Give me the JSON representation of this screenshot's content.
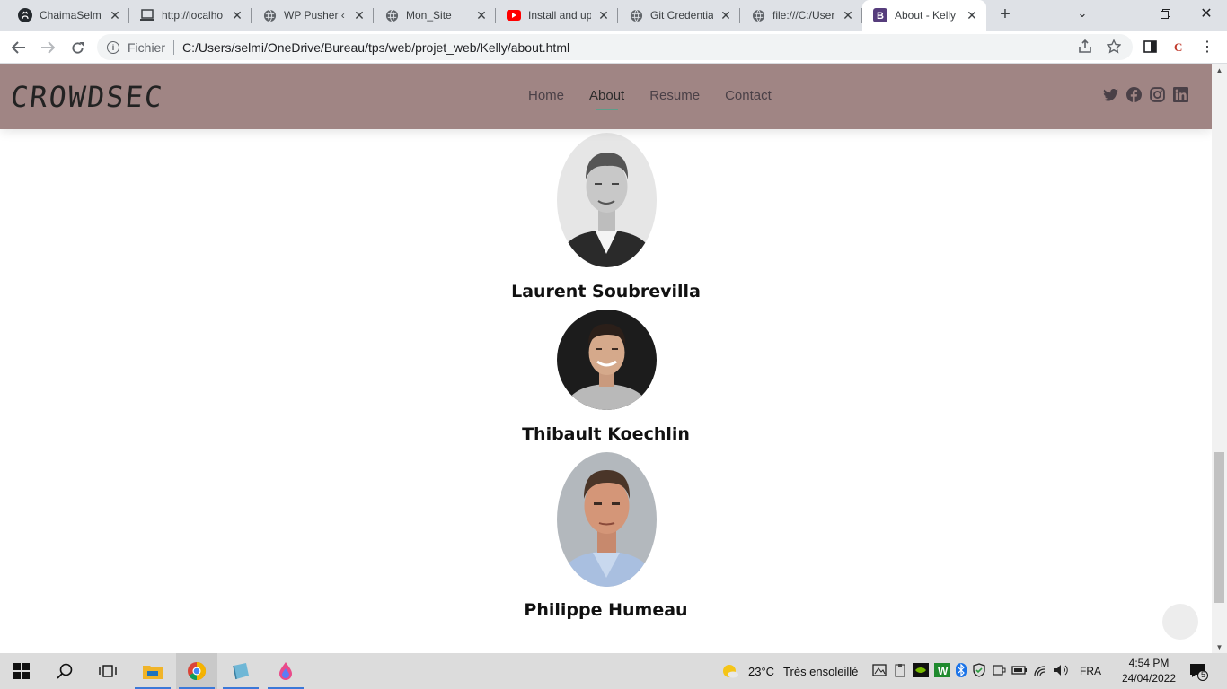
{
  "browser": {
    "tabs": [
      {
        "title": "ChaimaSelmi/",
        "icon": "github-icon"
      },
      {
        "title": "http://localho",
        "icon": "laptop-icon"
      },
      {
        "title": "WP Pusher ‹ M",
        "icon": "globe-icon"
      },
      {
        "title": "Mon_Site",
        "icon": "globe-icon"
      },
      {
        "title": "Install and up",
        "icon": "youtube-icon"
      },
      {
        "title": "Git Credential",
        "icon": "globe-icon"
      },
      {
        "title": "file:///C:/User",
        "icon": "globe-icon"
      },
      {
        "title": "About - Kelly",
        "icon": "bootstrap-icon",
        "active": true
      }
    ],
    "address": {
      "scheme_label": "Fichier",
      "url": "C:/Users/selmi/OneDrive/Bureau/tps/web/projet_web/Kelly/about.html"
    }
  },
  "site": {
    "logo": "CROWDSEC",
    "nav": [
      {
        "label": "Home"
      },
      {
        "label": "About",
        "active": true
      },
      {
        "label": "Resume"
      },
      {
        "label": "Contact"
      }
    ],
    "social": [
      "twitter-icon",
      "facebook-icon",
      "instagram-icon",
      "linkedin-icon"
    ],
    "team": [
      {
        "name": "Laurent Soubrevilla",
        "photo": "grayscale portrait"
      },
      {
        "name": "Thibault Koechlin",
        "photo": "color portrait"
      },
      {
        "name": "Philippe Humeau",
        "photo": "color portrait"
      }
    ],
    "accent_color": "#a08584",
    "underline_color": "#5c9e8a"
  },
  "taskbar": {
    "weather_temp": "23°C",
    "weather_text": "Très ensoleillé",
    "language": "FRA",
    "time": "4:54 PM",
    "date": "24/04/2022",
    "notification_count": "5"
  }
}
